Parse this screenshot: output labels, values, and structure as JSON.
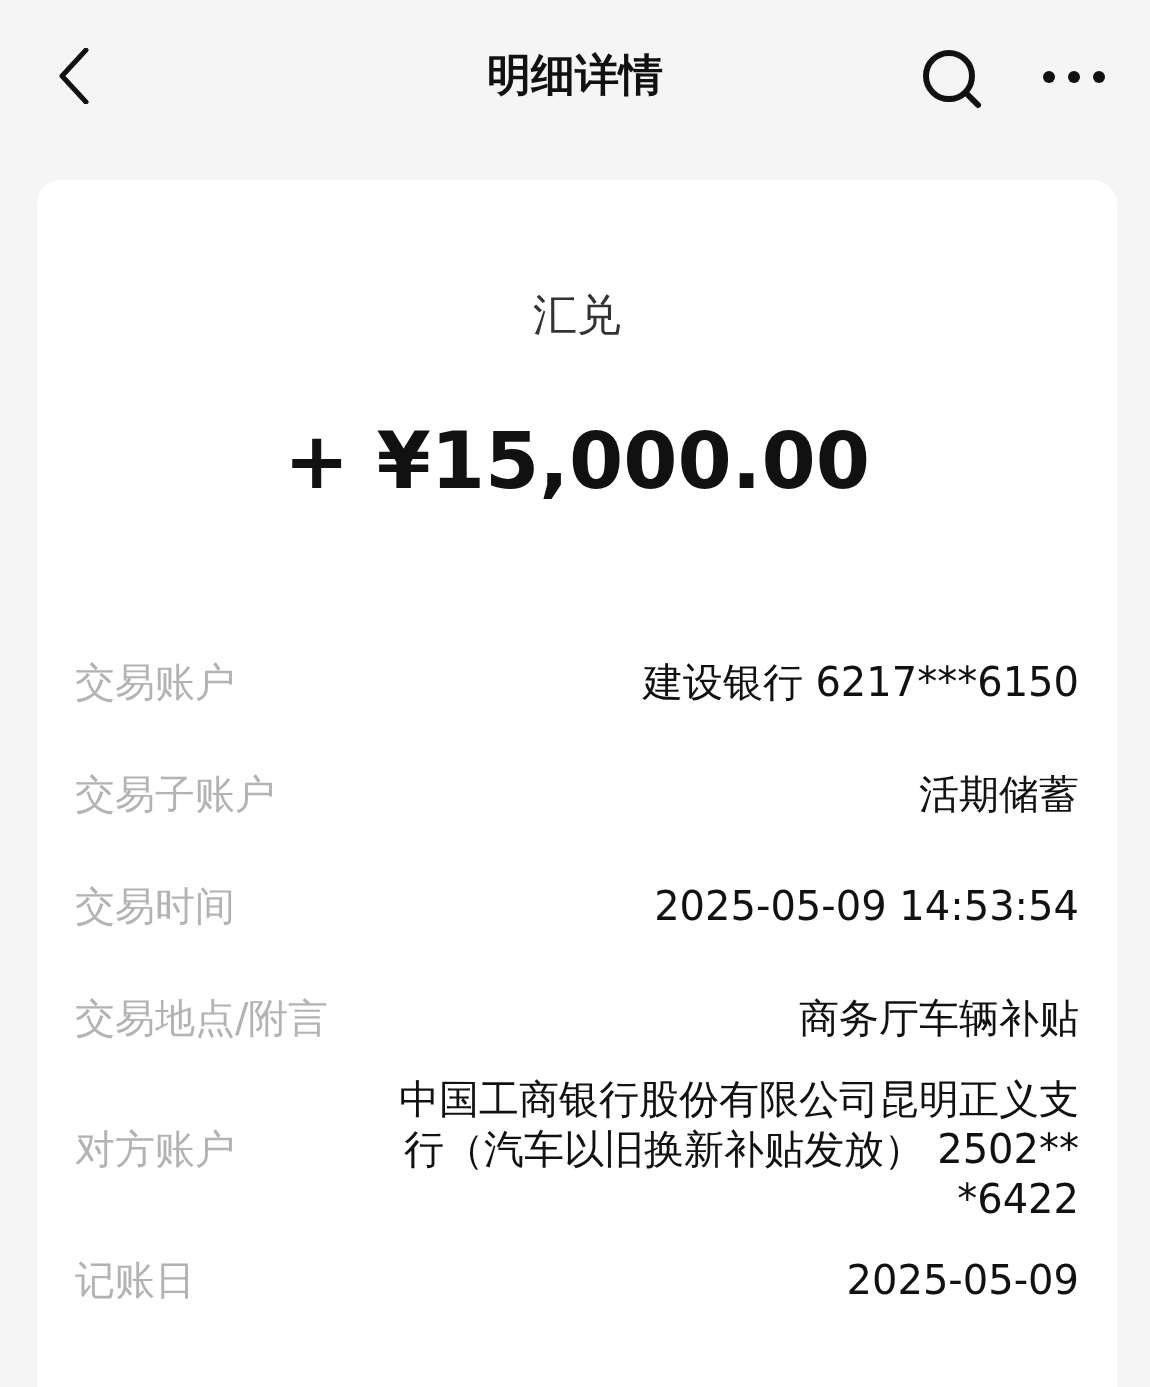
{
  "header": {
    "title": "明细详情"
  },
  "summary": {
    "type": "汇兑",
    "amount": "+ ¥15,000.00"
  },
  "details": [
    {
      "label": "交易账户",
      "value": "建设银行 6217***6150"
    },
    {
      "label": "交易子账户",
      "value": "活期储蓄"
    },
    {
      "label": "交易时间",
      "value": "2025-05-09 14:53:54"
    },
    {
      "label": "交易地点/附言",
      "value": "商务厅车辆补贴"
    },
    {
      "label": "对方账户",
      "value": "中国工商银行股份有限公司昆明正义支行（汽车以旧换新补贴发放） 2502***6422"
    },
    {
      "label": "记账日",
      "value": "2025-05-09"
    }
  ]
}
